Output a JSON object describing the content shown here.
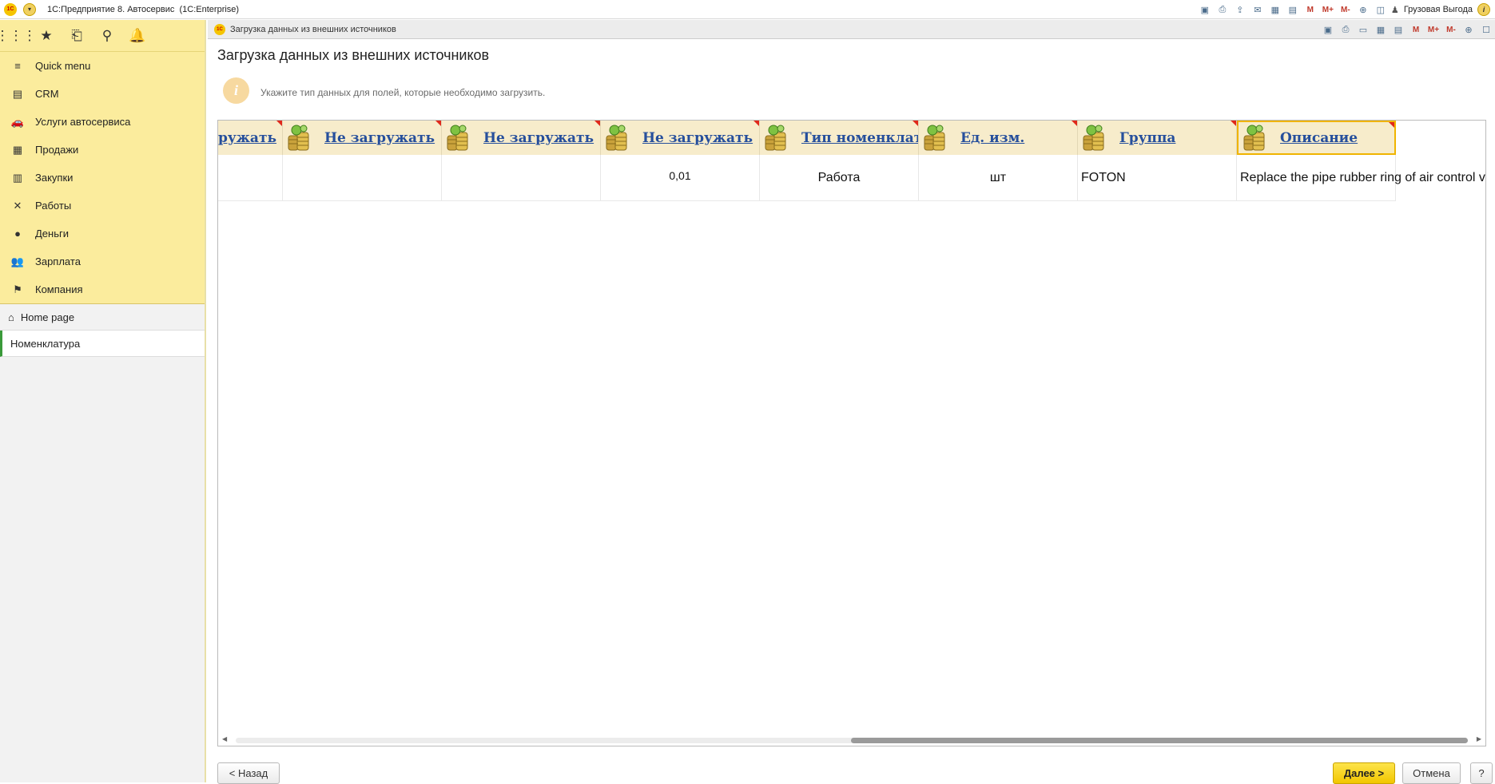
{
  "app": {
    "title": "1С:Предприятие 8. Автосервис  (1С:Enterprise)",
    "logo_text": "1С",
    "user_name": "Грузовая Выгода",
    "toolbar_icons": [
      "save-icon",
      "print-icon",
      "upload-icon",
      "mail-icon",
      "table-icon",
      "calendar-icon",
      "memory-m-icon",
      "memory-m-plus-icon",
      "memory-m-minus-icon",
      "zoom-icon",
      "panel-icon"
    ],
    "m_labels": [
      "M",
      "M+",
      "M-"
    ]
  },
  "sidebar": {
    "sections": [
      {
        "label": "Quick menu",
        "icon": "menu-icon",
        "glyph": "≡"
      },
      {
        "label": "CRM",
        "icon": "crm-icon",
        "glyph": "▤"
      },
      {
        "label": "Услуги автосервиса",
        "icon": "car-icon",
        "glyph": "🚗"
      },
      {
        "label": "Продажи",
        "icon": "shop-icon",
        "glyph": "▦"
      },
      {
        "label": "Закупки",
        "icon": "purchase-icon",
        "glyph": "▥"
      },
      {
        "label": "Работы",
        "icon": "tools-icon",
        "glyph": "✕"
      },
      {
        "label": "Деньги",
        "icon": "money-icon",
        "glyph": "●"
      },
      {
        "label": "Зарплата",
        "icon": "salary-icon",
        "glyph": "👥"
      },
      {
        "label": "Компания",
        "icon": "flag-icon",
        "glyph": "⚑"
      }
    ],
    "home_page": "Home page",
    "open_windows": [
      "Номенклатура"
    ]
  },
  "form": {
    "tab_title": "Загрузка данных из внешних источников",
    "title": "Загрузка данных из внешних источников",
    "hint": "Укажите тип данных для полей, которые необходимо загрузить.",
    "columns": [
      {
        "label": "ружать",
        "selected": false
      },
      {
        "label": "Не загружать",
        "selected": false
      },
      {
        "label": "Не загружать",
        "selected": false
      },
      {
        "label": "Не загружать",
        "selected": false
      },
      {
        "label": "Тип номенклатуры",
        "selected": false
      },
      {
        "label": "Ед. изм.",
        "selected": false
      },
      {
        "label": "Группа",
        "selected": false
      },
      {
        "label": "Описание",
        "selected": true
      }
    ],
    "row": [
      "",
      "",
      "",
      "0,01",
      "Работа",
      "шт",
      "FOTON",
      "Replace the pipe rubber ring of air control valve"
    ],
    "buttons": {
      "back": "< Назад",
      "next": "Далее >",
      "cancel": "Отмена",
      "help": "?"
    }
  },
  "colors": {
    "sidebar_bg": "#fbec9d",
    "header_cell_bg": "#f7eccb",
    "header_link": "#264f9c",
    "selected_border": "#f0b400",
    "next_button": "#f2c600"
  }
}
